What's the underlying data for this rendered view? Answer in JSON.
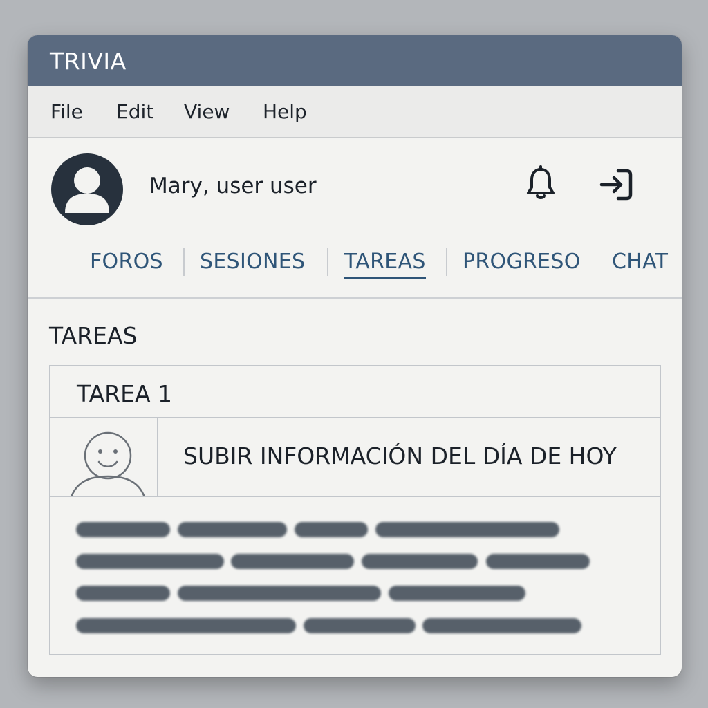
{
  "window": {
    "title": "TRIVIA"
  },
  "menu": {
    "items": [
      "File",
      "Edit",
      "View",
      "Help"
    ]
  },
  "header": {
    "user_name": "Mary, user user",
    "icons": {
      "avatar": "user-avatar-icon",
      "notifications": "bell-icon",
      "logout": "sign-in-arrow-icon"
    }
  },
  "tabs": {
    "items": [
      "FOROS",
      "SESIONES",
      "TAREAS",
      "PROGRESO",
      "CHAT"
    ],
    "active": "TAREAS"
  },
  "section": {
    "title": "TAREAS"
  },
  "task": {
    "label": "TAREA 1",
    "title": "SUBIR INFORMACIÓN DEL DÍA DE HOY",
    "thumbnail_icon": "smiley-person-icon",
    "description_blurred": true
  },
  "colors": {
    "titlebar": "#5a6a80",
    "accent": "#2f5578",
    "window_bg": "#f3f3f1",
    "desktop_bg": "#b3b6ba"
  }
}
